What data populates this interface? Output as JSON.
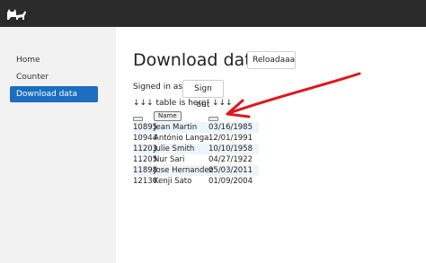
{
  "app": {
    "logo_icon": "cat-logo-icon",
    "topbar_color": "#2b2b2b",
    "accent": "#1b6ec2",
    "annotation_color": "#e0161c"
  },
  "sidebar": {
    "items": [
      {
        "label": "Home",
        "active": false
      },
      {
        "label": "Counter",
        "active": false
      },
      {
        "label": "Download data",
        "active": true
      }
    ]
  },
  "main": {
    "title": "Download data",
    "reload_label": "Reloadaaa",
    "signed_in_text": "Signed in as .",
    "sign_out_label": "Sign out",
    "table_hint": "↓↓↓ table is here! ↓↓↓",
    "table": {
      "name_header": "Name",
      "rows": [
        {
          "id": "10895",
          "name": "Jean Martin",
          "date": "03/16/1985"
        },
        {
          "id": "10944",
          "name": "António Langa",
          "date": "12/01/1991"
        },
        {
          "id": "11203",
          "name": "Julie Smith",
          "date": "10/10/1958"
        },
        {
          "id": "11205",
          "name": "Nur Sari",
          "date": "04/27/1922"
        },
        {
          "id": "11898",
          "name": "Jose Hernandez",
          "date": "05/03/2011"
        },
        {
          "id": "12130",
          "name": "Kenji Sato",
          "date": "01/09/2004"
        }
      ]
    }
  }
}
